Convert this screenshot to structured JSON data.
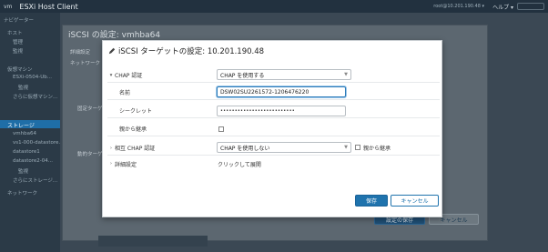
{
  "app": {
    "vm_label": "vm",
    "title": "ESXi Host Client",
    "user_text": "root@10.201.190.48 ▾",
    "help_label": "ヘルプ ▾"
  },
  "sidebar": {
    "items": [
      {
        "label": "ナビゲーター"
      },
      {
        "label": "ホスト"
      },
      {
        "label": "管理"
      },
      {
        "label": "監視"
      },
      {
        "label": "仮想マシン"
      },
      {
        "label": "ESXi-0504-Ub..."
      },
      {
        "label": "監視"
      },
      {
        "label": "さらに仮想マシン..."
      },
      {
        "label": "ストレージ"
      },
      {
        "label": "vmhba64"
      },
      {
        "label": "vs1-000-datastore..."
      },
      {
        "label": "datastore1"
      },
      {
        "label": "datastore2-04..."
      },
      {
        "label": "監視"
      },
      {
        "label": "さらにストレージ..."
      },
      {
        "label": "ネットワーク"
      }
    ]
  },
  "bg_dialog": {
    "title": "iSCSI の設定: vmhba64",
    "labels": [
      "詳細設定",
      "ネットワーク",
      "固定ターゲット",
      "動的ターゲット"
    ],
    "save_label": "設定の保存",
    "cancel_label": "キャンセル"
  },
  "modal": {
    "title": "iSCSI ターゲットの設定: 10.201.190.48",
    "chap": {
      "label": "CHAP 認証",
      "select_value": "CHAP を使用する",
      "name_label": "名前",
      "name_value": "DSW02SU2261572-1206476220",
      "secret_label": "シークレット",
      "secret_value": "••••••••••••••••••••••••••",
      "inherit_label": "親から継承"
    },
    "mutual_chap": {
      "label": "相互 CHAP 認証",
      "select_value": "CHAP を使用しない",
      "inherit_label": "親から継承"
    },
    "advanced": {
      "label": "詳細設定",
      "value": "クリックして展開"
    },
    "save_label": "保存",
    "cancel_label": "キャンセル"
  },
  "colors": {
    "primary": "#1f73ad",
    "focus": "#2b7bb9",
    "sidebar_selected": "#1f6ea7"
  }
}
